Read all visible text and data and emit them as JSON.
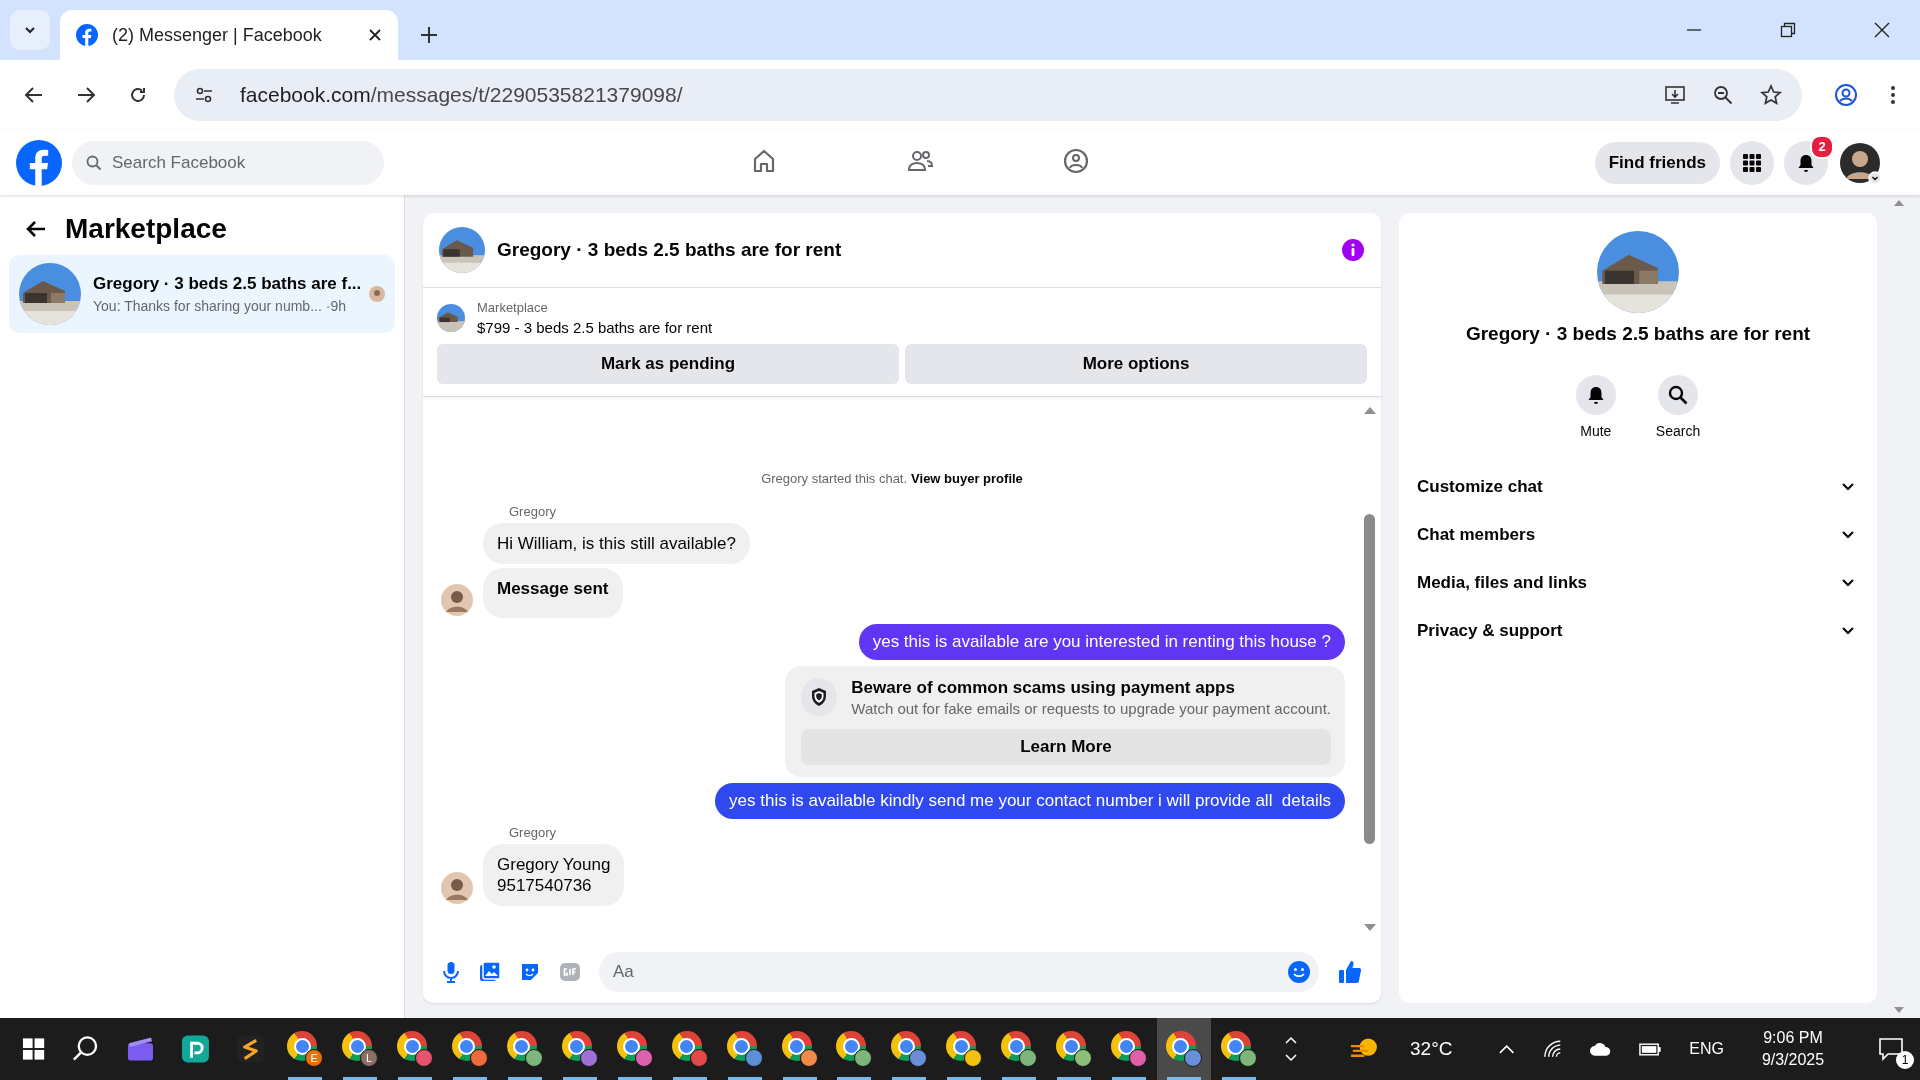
{
  "browser": {
    "tab_title": "(2) Messenger | Facebook",
    "url_domain": "facebook.com",
    "url_path": "/messages/t/2290535821379098/"
  },
  "header": {
    "search_placeholder": "Search Facebook",
    "nav": [
      {
        "kind": "home",
        "selected": false
      },
      {
        "kind": "friends",
        "selected": false
      },
      {
        "kind": "groups",
        "selected": false
      }
    ],
    "find_friends": "Find friends",
    "notification_count": "2"
  },
  "sidebar": {
    "title": "Marketplace",
    "conversations": [
      {
        "title": "Gregory · 3 beds 2.5 baths are f...",
        "preview": "You: Thanks for sharing your numb...",
        "time": "·9h",
        "selected": true
      }
    ]
  },
  "chat": {
    "title": "Gregory · 3 beds 2.5 baths are for rent",
    "listing": {
      "label": "Marketplace",
      "text": "$799 - 3 beds 2.5 baths are for rent"
    },
    "actions": [
      "Mark as pending",
      "More options"
    ],
    "intro": {
      "text": "Gregory started this chat.",
      "link": "View buyer profile"
    },
    "messages": [
      {
        "kind": "incoming",
        "sender": "Gregory",
        "bubbles": [
          {
            "text": "Hi William, is this still available?",
            "bold": false
          },
          {
            "text": "Message sent",
            "bold": true
          }
        ]
      },
      {
        "kind": "outgoing",
        "text": "yes this is available are you interested in renting this house ?",
        "color": "#6135f4"
      },
      {
        "kind": "notice",
        "title": "Beware of common scams using payment apps",
        "body": "Watch out for fake emails or requests to upgrade your payment account.",
        "button": "Learn More"
      },
      {
        "kind": "outgoing",
        "text": "yes this is available kindly send me your contact number i will provide all  details",
        "color": "#3049ee"
      },
      {
        "kind": "incoming",
        "sender": "Gregory",
        "bubbles": [
          {
            "text": "Gregory Young\n9517540736",
            "bold": false
          }
        ]
      }
    ],
    "composer_placeholder": "Aa"
  },
  "details": {
    "title": "Gregory · 3 beds 2.5 baths are for rent",
    "actions": [
      {
        "kind": "mute",
        "label": "Mute"
      },
      {
        "kind": "search",
        "label": "Search"
      }
    ],
    "sections": [
      {
        "label": "Customize chat",
        "expanded": false
      },
      {
        "label": "Chat members",
        "expanded": false
      },
      {
        "label": "Media, files and links",
        "expanded": false
      },
      {
        "label": "Privacy & support",
        "expanded": false
      }
    ]
  },
  "taskbar": {
    "apps": [
      {
        "kind": "browser",
        "badge": "E",
        "color": "#e8710a",
        "selected": false
      },
      {
        "kind": "browser",
        "badge": "L",
        "color": "#8d6e63",
        "selected": false
      },
      {
        "kind": "browser",
        "color": "#e5536d",
        "selected": false
      },
      {
        "kind": "browser",
        "color": "#f06a3a",
        "selected": false
      },
      {
        "kind": "browser",
        "color": "#7cb67a",
        "selected": false
      },
      {
        "kind": "browser",
        "color": "#a070d8",
        "selected": false
      },
      {
        "kind": "browser",
        "color": "#e060b0",
        "selected": false
      },
      {
        "kind": "browser",
        "color": "#e54848",
        "selected": false
      },
      {
        "kind": "browser",
        "color": "#5b8fd8",
        "selected": false
      },
      {
        "kind": "browser",
        "color": "#f08a4a",
        "selected": false
      },
      {
        "kind": "browser",
        "color": "#7cb67a",
        "selected": false
      },
      {
        "kind": "browser",
        "color": "#6a8fd8",
        "selected": false
      },
      {
        "kind": "browser",
        "color": "#f4c20d",
        "selected": false
      },
      {
        "kind": "browser",
        "color": "#7cb67a",
        "selected": false
      },
      {
        "kind": "browser",
        "color": "#8cc07a",
        "selected": false
      },
      {
        "kind": "browser",
        "color": "#e060a8",
        "selected": false
      },
      {
        "kind": "browser",
        "color": "#6a8fd8",
        "selected": true
      },
      {
        "kind": "browser",
        "color": "#7cb67a",
        "selected": false
      }
    ],
    "temperature": "32°C",
    "language": "ENG",
    "time": "9:06 PM",
    "date": "9/3/2025",
    "notification_count": "1"
  }
}
